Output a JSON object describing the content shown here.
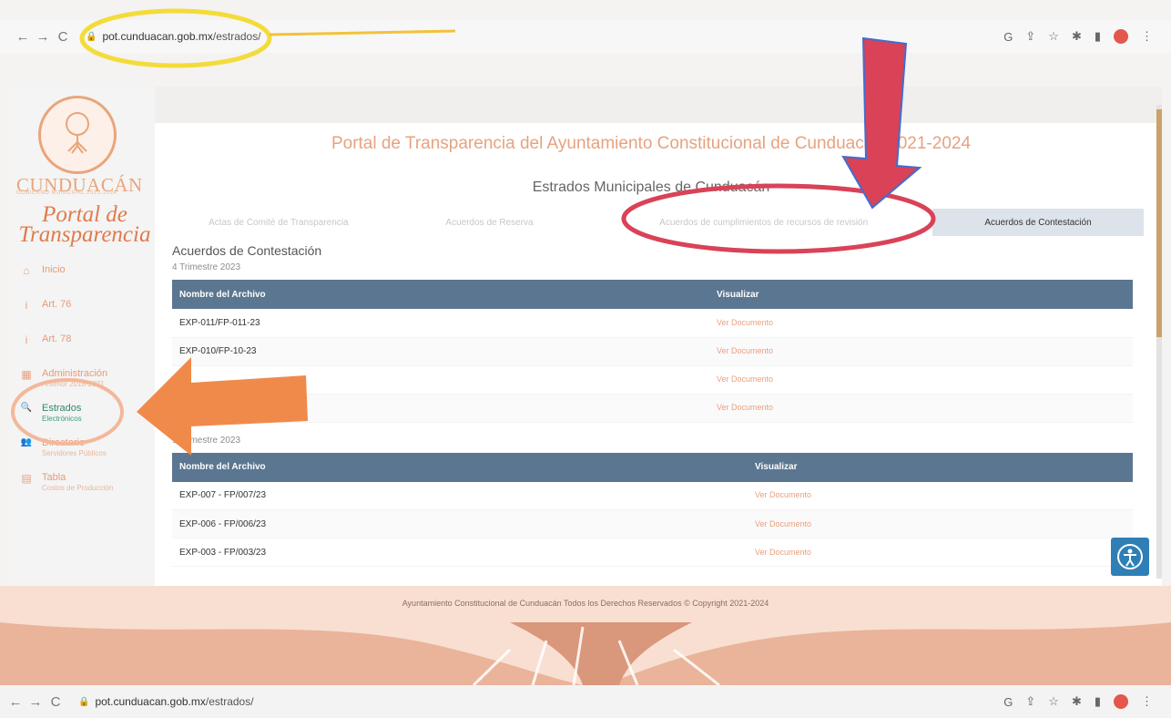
{
  "browser": {
    "url_domain": "pot.cunduacan.gob.mx",
    "url_path": "/estrados/",
    "back_glyph": "←",
    "forward_glyph": "→",
    "reload_glyph": "C",
    "lock_glyph": "🔒",
    "icons": [
      "google-icon",
      "share-icon",
      "star-icon",
      "extensions-icon",
      "sidebar-icon",
      "profile-icon",
      "menu-icon"
    ],
    "icon_glyphs": {
      "google": "G",
      "share": "⇪",
      "star": "☆",
      "extensions": "✱",
      "sidebar": "▮",
      "menu": "⋮"
    }
  },
  "sidebar": {
    "brand": "CUNDUACÁN",
    "brand_sub": "GOBIERNO MUNICIPAL 2021-2024",
    "portal_title": "Portal de Transparencia",
    "items": [
      {
        "label": "Inicio",
        "sub": "",
        "icon": "home-icon",
        "glyph": "⌂"
      },
      {
        "label": "Art. 76",
        "sub": "",
        "icon": "info-icon",
        "glyph": "i"
      },
      {
        "label": "Art. 78",
        "sub": "",
        "icon": "info-icon",
        "glyph": "i"
      },
      {
        "label": "Administración",
        "sub": "Anterior 2018-2021",
        "icon": "calendar-icon",
        "glyph": "▦"
      },
      {
        "label": "Estrados",
        "sub": "Electrónicos",
        "icon": "search-icon",
        "glyph": "🔍"
      },
      {
        "label": "Directorio",
        "sub": "Servidores Públicos",
        "icon": "people-icon",
        "glyph": "👥"
      },
      {
        "label": "Tabla",
        "sub": "Costos de Producción",
        "icon": "table-icon",
        "glyph": "▤"
      }
    ]
  },
  "main": {
    "title": "Portal de Transparencia del Ayuntamiento Constitucional de Cunduacán 2021-2024",
    "section_title": "Estrados Municipales de Cunduacán",
    "tabs": [
      {
        "label": "Actas de Comité de Transparencia",
        "active": false
      },
      {
        "label": "Acuerdos de Reserva",
        "active": false
      },
      {
        "label": "Acuerdos de cumplimientos de recursos de revisión",
        "active": false
      },
      {
        "label": "Acuerdos de Contestación",
        "active": true
      }
    ],
    "content_title": "Acuerdos de Contestación",
    "groups": [
      {
        "period": "4 Trimestre 2023",
        "headers": [
          "Nombre del Archivo",
          "Visualizar"
        ],
        "rows": [
          {
            "name": "EXP-011/FP-011-23",
            "link": "Ver Documento"
          },
          {
            "name": "EXP-010/FP-10-23",
            "link": "Ver Documento"
          },
          {
            "name": "",
            "link": "Ver Documento"
          },
          {
            "name": "",
            "link": "Ver Documento"
          }
        ]
      },
      {
        "period": "1 Trimestre 2023",
        "headers": [
          "Nombre del Archivo",
          "Visualizar"
        ],
        "rows": [
          {
            "name": "EXP-007 - FP/007/23",
            "link": "Ver Documento"
          },
          {
            "name": "EXP-006 - FP/006/23",
            "link": "Ver Documento"
          },
          {
            "name": "EXP-003 - FP/003/23",
            "link": "Ver Documento"
          }
        ]
      }
    ]
  },
  "footer": {
    "text": "Ayuntamiento Constitucional de Cunduacán Todos los Derechos Reservados © Copyright 2021-2024"
  },
  "colors": {
    "brand_orange": "#e07b4b",
    "table_header": "#5b7690",
    "active_green": "#2f8a6a",
    "annotation_red": "#d94257",
    "annotation_orange": "#f08a4b",
    "annotation_yellow": "#f3dc3a",
    "accessibility_blue": "#2f7fb6"
  }
}
